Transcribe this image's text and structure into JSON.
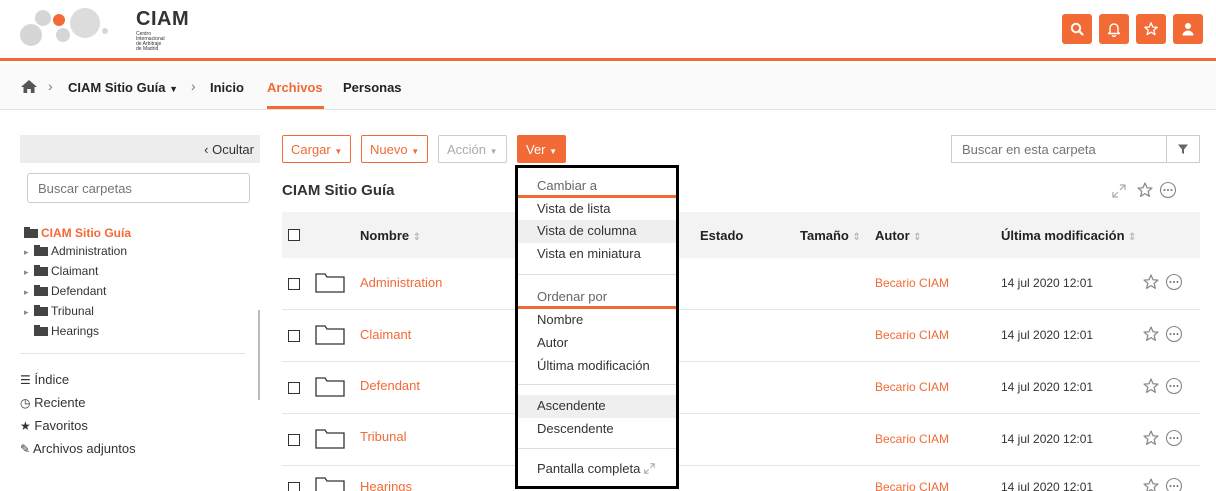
{
  "brand": {
    "title": "CIAM",
    "subtitle_lines": [
      "Centro",
      "Internacional",
      "de Arbitraje",
      "de Madrid"
    ],
    "accent": "#f26a36"
  },
  "header_buttons": [
    {
      "name": "search-button",
      "icon": "search-icon"
    },
    {
      "name": "notifications-button",
      "icon": "bell-icon"
    },
    {
      "name": "favorites-button",
      "icon": "star-icon"
    },
    {
      "name": "user-button",
      "icon": "user-icon"
    }
  ],
  "breadcrumb": {
    "site": "CIAM Sitio Guía",
    "links": [
      "Inicio",
      "Archivos",
      "Personas"
    ],
    "active": "Archivos"
  },
  "sidebar": {
    "hide_label": "Ocultar",
    "search_placeholder": "Buscar carpetas",
    "tree": [
      {
        "label": "CIAM Sitio Guía",
        "active": true
      },
      {
        "label": "Administration"
      },
      {
        "label": "Claimant"
      },
      {
        "label": "Defendant"
      },
      {
        "label": "Tribunal"
      },
      {
        "label": "Hearings"
      }
    ],
    "nav": [
      "Índice",
      "Reciente",
      "Favoritos",
      "Archivos adjuntos"
    ]
  },
  "toolbar": {
    "upload": "Cargar",
    "new": "Nuevo",
    "action": "Acción",
    "view": "Ver",
    "search_placeholder": "Buscar en esta carpeta"
  },
  "folder_title": "CIAM Sitio Guía",
  "table": {
    "headers": {
      "name": "Nombre",
      "state": "Estado",
      "size": "Tamaño",
      "author": "Autor",
      "modified": "Última modificación"
    },
    "rows": [
      {
        "name": "Administration",
        "author": "Becario CIAM",
        "date": "14 jul 2020 12:01"
      },
      {
        "name": "Claimant",
        "author": "Becario CIAM",
        "date": "14 jul 2020 12:01"
      },
      {
        "name": "Defendant",
        "author": "Becario CIAM",
        "date": "14 jul 2020 12:01"
      },
      {
        "name": "Tribunal",
        "author": "Becario CIAM",
        "date": "14 jul 2020 12:01"
      },
      {
        "name": "Hearings",
        "author": "Becario CIAM",
        "date": "14 jul 2020 12:01"
      }
    ]
  },
  "view_menu": {
    "change_header": "Cambiar a",
    "views": [
      "Vista de lista",
      "Vista de columna",
      "Vista en miniatura"
    ],
    "sort_header": "Ordenar por",
    "sorts": [
      "Nombre",
      "Autor",
      "Última modificación"
    ],
    "orders": [
      "Ascendente",
      "Descendente"
    ],
    "fullscreen": "Pantalla completa"
  }
}
